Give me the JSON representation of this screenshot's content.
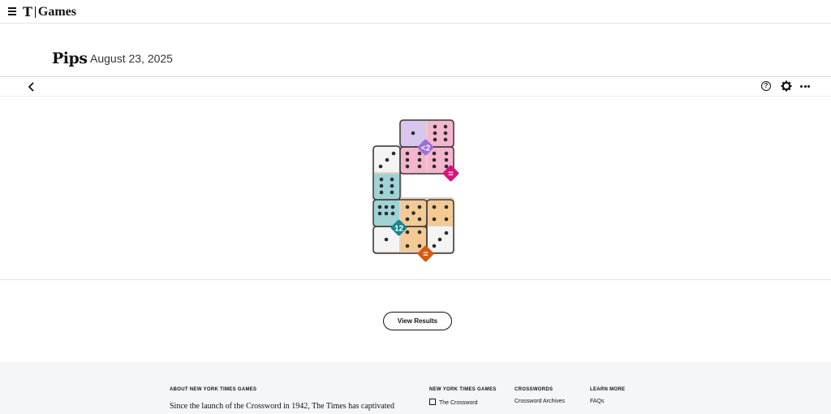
{
  "header": {
    "logo": "T",
    "brand": "Games"
  },
  "game": {
    "title": "Pips",
    "date": "August 23, 2025"
  },
  "toolbar": {
    "back_icon": "chevron-left-icon",
    "help_icon": "help-circle-icon",
    "help_glyph": "?",
    "settings_icon": "gear-icon",
    "more_icon": "more-horizontal-icon"
  },
  "puzzle": {
    "regions": [
      {
        "label": "<2",
        "color": "#9b6fd6",
        "fill": "#d8c6ef"
      },
      {
        "label": "=",
        "color": "#d6157d",
        "fill": "#f4b5cf"
      },
      {
        "label": "12",
        "color": "#16878f",
        "fill": "#9fd3d6"
      },
      {
        "label": "=",
        "color": "#d75a0e",
        "fill": "#f3c994"
      }
    ]
  },
  "results_button": "View Results",
  "footer": {
    "about_title": "ABOUT NEW YORK TIMES GAMES",
    "about_text": "Since the launch of the Crossword in 1942, The Times has captivated",
    "col1_title": "NEW YORK TIMES GAMES",
    "col1_items": [
      "The Crossword"
    ],
    "col2_title": "CROSSWORDS",
    "col2_items": [
      "Crossword Archives"
    ],
    "col3_title": "LEARN MORE",
    "col3_items": [
      "FAQs"
    ]
  }
}
